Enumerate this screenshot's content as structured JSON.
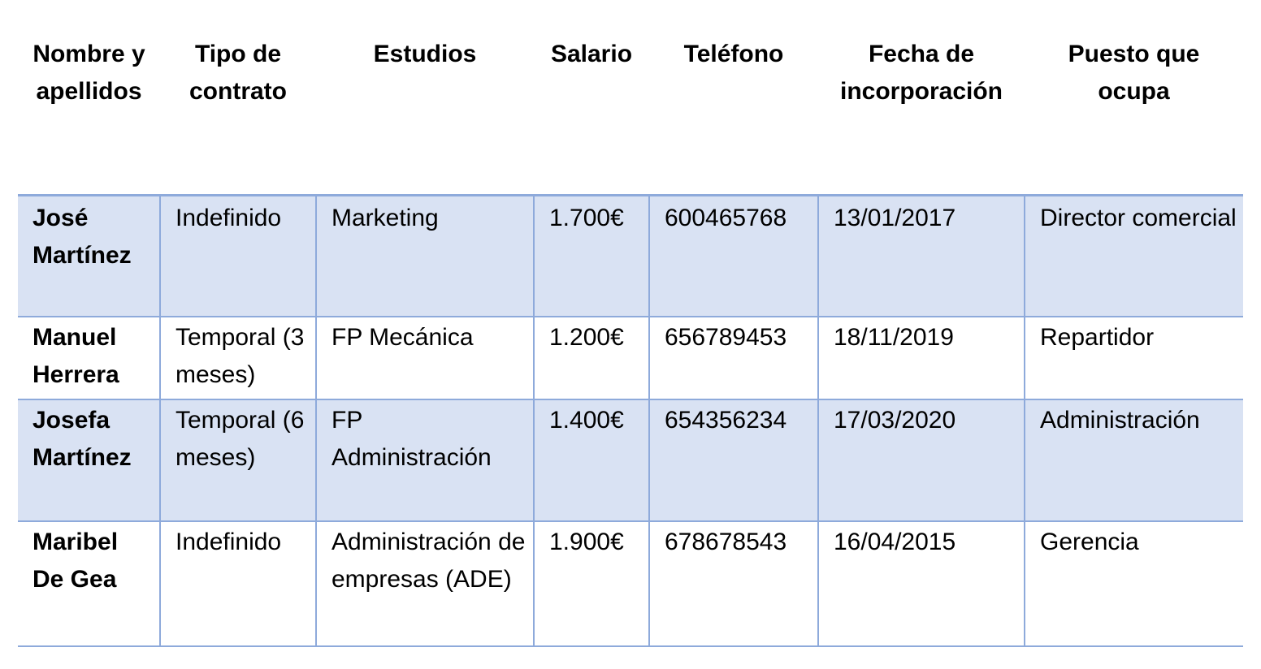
{
  "headers": [
    "Nombre y apellidos",
    "Tipo de contrato",
    "Estudios",
    "Salario",
    "Teléfono",
    "Fecha de incorporación",
    "Puesto que ocupa"
  ],
  "rows": [
    {
      "nombre": "José Martínez",
      "contrato": "Indefinido",
      "estudios": "Marketing",
      "salario": "1.700€",
      "telefono": "600465768",
      "fecha": "13/01/2017",
      "puesto": "Director comercial"
    },
    {
      "nombre": "Manuel Herrera",
      "contrato": "Temporal (3 meses)",
      "estudios": "FP Mecánica",
      "salario": "1.200€",
      "telefono": "656789453",
      "fecha": "18/11/2019",
      "puesto": "Repartidor"
    },
    {
      "nombre": "Josefa Martínez",
      "contrato": "Temporal (6 meses)",
      "estudios": "FP Administración",
      "salario": "1.400€",
      "telefono": "654356234",
      "fecha": "17/03/2020",
      "puesto": "Administración"
    },
    {
      "nombre": "Maribel De Gea",
      "contrato": "Indefinido",
      "estudios": "Administración de empresas (ADE)",
      "salario": "1.900€",
      "telefono": "678678543",
      "fecha": "16/04/2015",
      "puesto": "Gerencia"
    }
  ],
  "colors": {
    "shade": "#d9e2f3",
    "border": "#8eaadb"
  }
}
